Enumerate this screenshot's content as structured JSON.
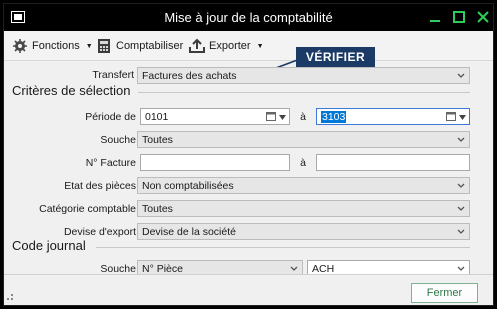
{
  "window": {
    "title": "Mise à jour de la comptabilité"
  },
  "toolbar": {
    "functions_label": "Fonctions",
    "post_label": "Comptabiliser",
    "export_label": "Exporter"
  },
  "annotation": {
    "label": "VÉRIFIER"
  },
  "form": {
    "transfert_label": "Transfert",
    "transfert_value": "Factures des achats",
    "criteria_title": "Critères de sélection",
    "periode_label": "Période de",
    "periode_from": "0101",
    "periode_to_label": "à",
    "periode_to": "3103",
    "souche_label": "Souche",
    "souche_value": "Toutes",
    "facture_label": "N° Facture",
    "facture_from": "",
    "facture_to_label": "à",
    "facture_to": "",
    "etat_label": "Etat des pièces",
    "etat_value": "Non comptabilisées",
    "categorie_label": "Catégorie comptable",
    "categorie_value": "Toutes",
    "devise_label": "Devise d'export",
    "devise_value": "Devise de la société",
    "journal_title": "Code journal",
    "journal_souche_label": "Souche",
    "journal_souche_value": "N° Pièce",
    "journal_code_value": "ACH"
  },
  "footer": {
    "close_label": "Fermer"
  },
  "colors": {
    "titlebar": "#000000",
    "accent_green": "#2f7a4a",
    "annotation_bg": "#1b3a66",
    "selection": "#0078d7"
  }
}
